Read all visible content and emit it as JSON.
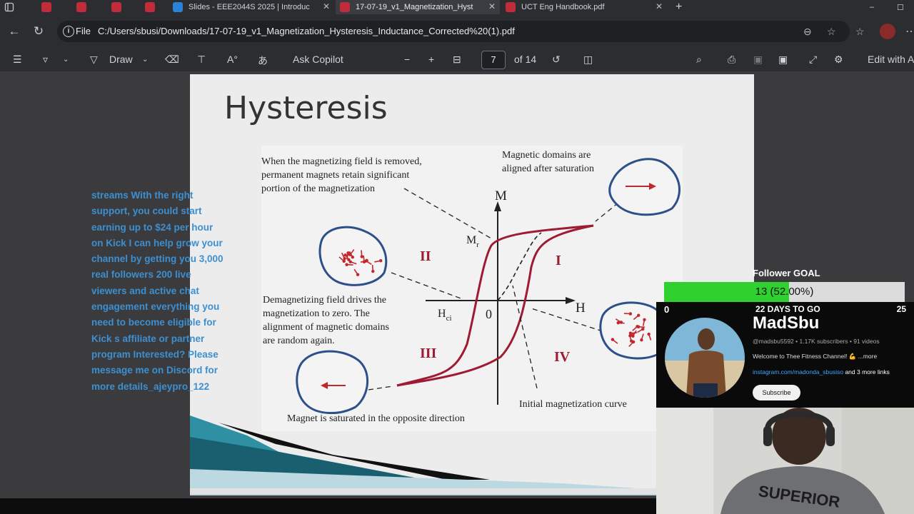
{
  "tabs": [
    {
      "label": "",
      "icon": "pdf"
    },
    {
      "label": "",
      "icon": "pdf"
    },
    {
      "label": "",
      "icon": "pdf"
    },
    {
      "label": "Slides - EEE2044S 2025 | Introduc",
      "icon": "slides"
    },
    {
      "label": "17-07-19_v1_Magnetization_Hyst",
      "icon": "pdf"
    },
    {
      "label": "UCT Eng Handbook.pdf",
      "icon": "pdf"
    }
  ],
  "address": {
    "scheme_label": "File",
    "url": "C:/Users/sbusi/Downloads/17-07-19_v1_Magnetization_Hysteresis_Inductance_Corrected%20(1).pdf"
  },
  "toolbar": {
    "draw_label": "Draw",
    "ask_copilot_label": "Ask Copilot",
    "page_current": "7",
    "page_total_label": "of 14",
    "edit_label": "Edit with A"
  },
  "slide": {
    "title": "Hysteresis",
    "diagram": {
      "annotation_removed_field": [
        "When the magnetizing  field is removed,",
        "permanent magnets retain significant",
        "portion of the magnetization"
      ],
      "annotation_saturation": [
        "Magnetic  domains are",
        "aligned after saturation"
      ],
      "annotation_demagnetizing": [
        "Demagnetizing  field drives the",
        "magnetization  to zero. The",
        "alignment of magnetic domains",
        "are random again."
      ],
      "annotation_opposite": "Magnet  is saturated in the opposite direction",
      "annotation_initial": "Initial magnetization  curve",
      "axis_m": "M",
      "axis_h": "H",
      "label_mr": "M",
      "label_mr_sub": "r",
      "label_hci": "H",
      "label_hci_sub": "ci",
      "label_origin": "0",
      "quadrants": [
        "I",
        "II",
        "III",
        "IV"
      ]
    }
  },
  "overlay_ad": "streams With the right support, you could start earning up to $24 per hour on Kick I can help grow your channel by getting you 3,000 real followers 200 live viewers and active chat engagement everything you need to become eligible for Kick s affiliate or partner program Interested? Please message me on Discord for more details_ajeypro_122",
  "follower_goal": {
    "title": "Follower GOAL",
    "progress_text": "13 (52.00%)",
    "progress_fraction": 0.52,
    "start": "0",
    "end": "25",
    "days_left": "22 DAYS TO GO"
  },
  "channel": {
    "name": "MadSbu",
    "meta": "@madsbu5592 • 1.17K subscribers • 91 videos",
    "description": "Welcome to Thee Fitness Channel! 💪 ...more",
    "link": "instagram.com/madonda_sbusiso",
    "link_suffix": " and 3 more links",
    "subscribe_label": "Subscribe"
  },
  "webcam": {
    "shirt_text": "SUPERIOR"
  },
  "colors": {
    "chrome_bg": "#2b2d31",
    "goal_fill": "#2ed12e",
    "ad_text": "#3c8fd0",
    "curve": "#9e1b32",
    "domain_arrow": "#c1272d",
    "domain_outline": "#2d4f8a"
  }
}
